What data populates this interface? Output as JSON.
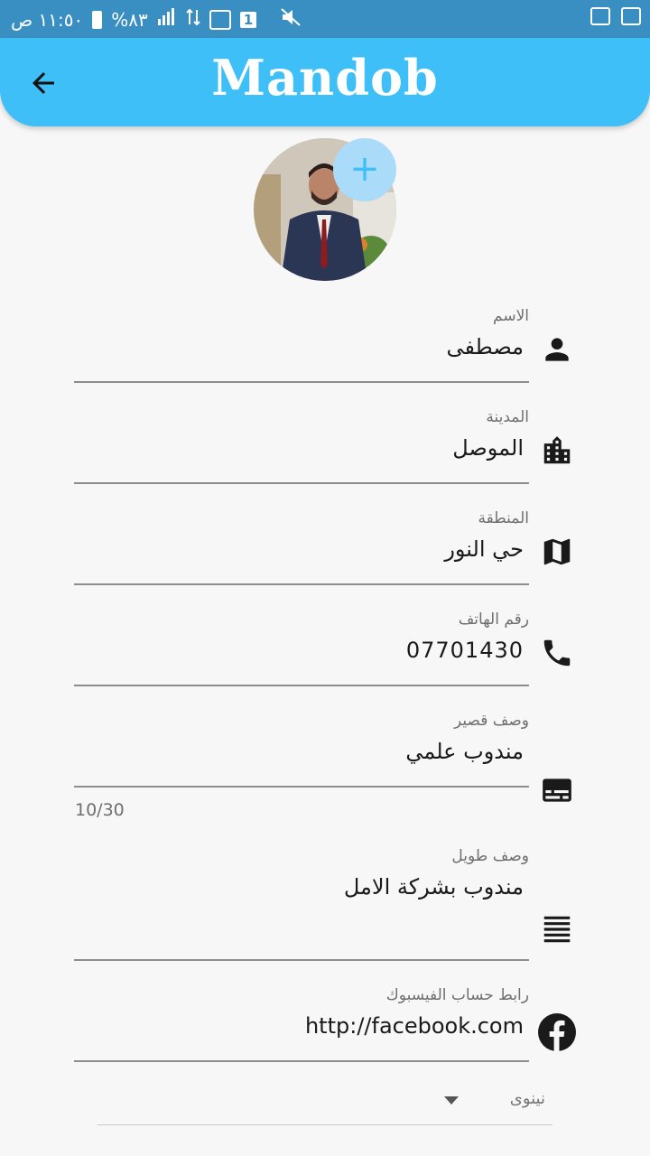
{
  "status_bar": {
    "time": "١١:٥٠ ص",
    "battery": "%٨٣",
    "sim_slot": "1"
  },
  "app_bar": {
    "title": "Mandob"
  },
  "colors": {
    "primary": "#3fbff8",
    "add_button_bg": "#aadcf9",
    "text": "#1a1a1a",
    "label": "#6f6f6f"
  },
  "form": {
    "name": {
      "label": "الاسم",
      "value": "مصطفى",
      "icon": "person-icon"
    },
    "city": {
      "label": "المدينة",
      "value": "الموصل",
      "icon": "city-icon"
    },
    "area": {
      "label": "المنطقة",
      "value": "حي النور",
      "icon": "map-icon"
    },
    "phone": {
      "label": "رقم الهاتف",
      "value": "07701430",
      "icon": "phone-icon"
    },
    "short_desc": {
      "label": "وصف قصير",
      "value": "مندوب علمي",
      "counter": "10/30",
      "icon": "subtitles-icon"
    },
    "long_desc": {
      "label": "وصف طويل",
      "value": "مندوب بشركة الامل",
      "icon": "notes-icon"
    },
    "facebook": {
      "label": "رابط حساب الفيسبوك",
      "value": "http://facebook.com",
      "icon": "facebook-icon"
    },
    "dropdown": {
      "selected": "نينوى"
    }
  }
}
